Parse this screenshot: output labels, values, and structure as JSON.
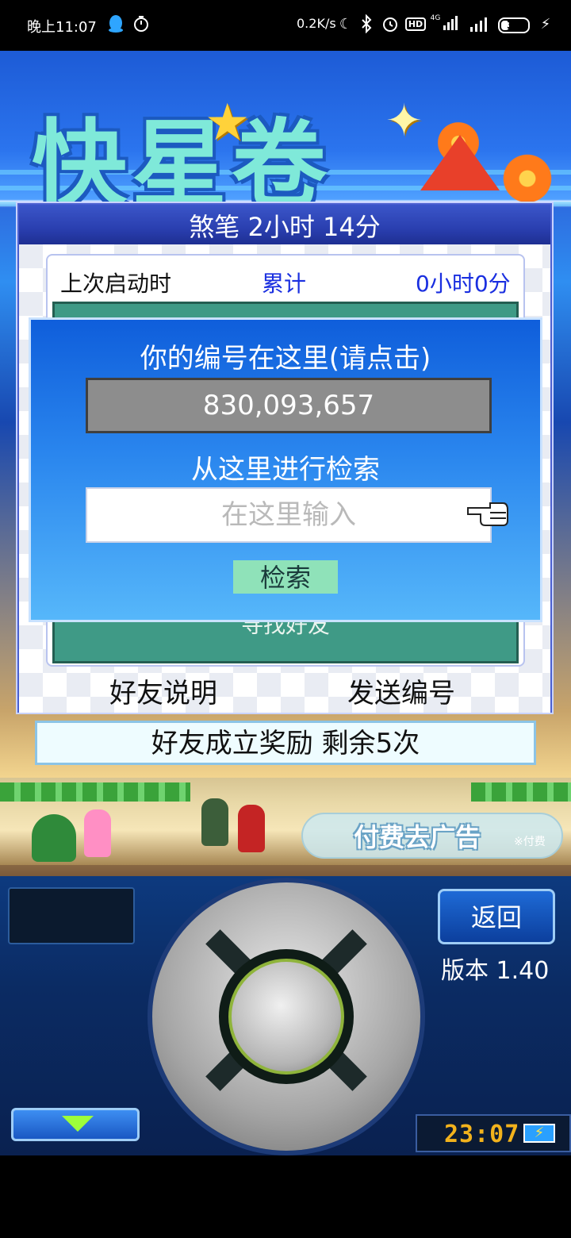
{
  "status_bar": {
    "time": "晚上11:07",
    "network_speed": "0.2K/s",
    "network_type": "4G",
    "battery": "31",
    "battery_level": 0.31,
    "icons": [
      "qq-penguin-icon",
      "timer-icon",
      "moon-icon",
      "bluetooth-icon",
      "alarm-icon",
      "hd-icon",
      "signal-icon",
      "signal-icon",
      "battery-icon",
      "charging-icon"
    ]
  },
  "game": {
    "panel_title": "煞笔  2小时 14分",
    "last_start_label": "上次启动时",
    "total_label": "累计",
    "total_value": "0小时0分",
    "find_friend_label": "寻找好友",
    "friend_explain_label": "好友说明",
    "send_id_label": "发送编号",
    "reward_text": "好友成立奖励  剩余5次",
    "ad_text": "付费去广告",
    "ad_note": "※付费"
  },
  "dialog": {
    "title": "你的编号在这里(请点击)",
    "id_value": "830,093,657",
    "search_label": "从这里进行检索",
    "search_placeholder": "在这里输入",
    "search_button": "检索"
  },
  "controller": {
    "back_button": "返回",
    "version": "版本 1.40",
    "clock": "23:07",
    "battery_symbol": "⚡"
  },
  "colors": {
    "dialog_top": "#0f5edb",
    "dialog_bottom": "#56b7fa",
    "accent_blue": "#1a2fe0",
    "search_button": "#8fe2b9",
    "green_area": "#3f9a86",
    "clock_text": "#f2b21c"
  }
}
